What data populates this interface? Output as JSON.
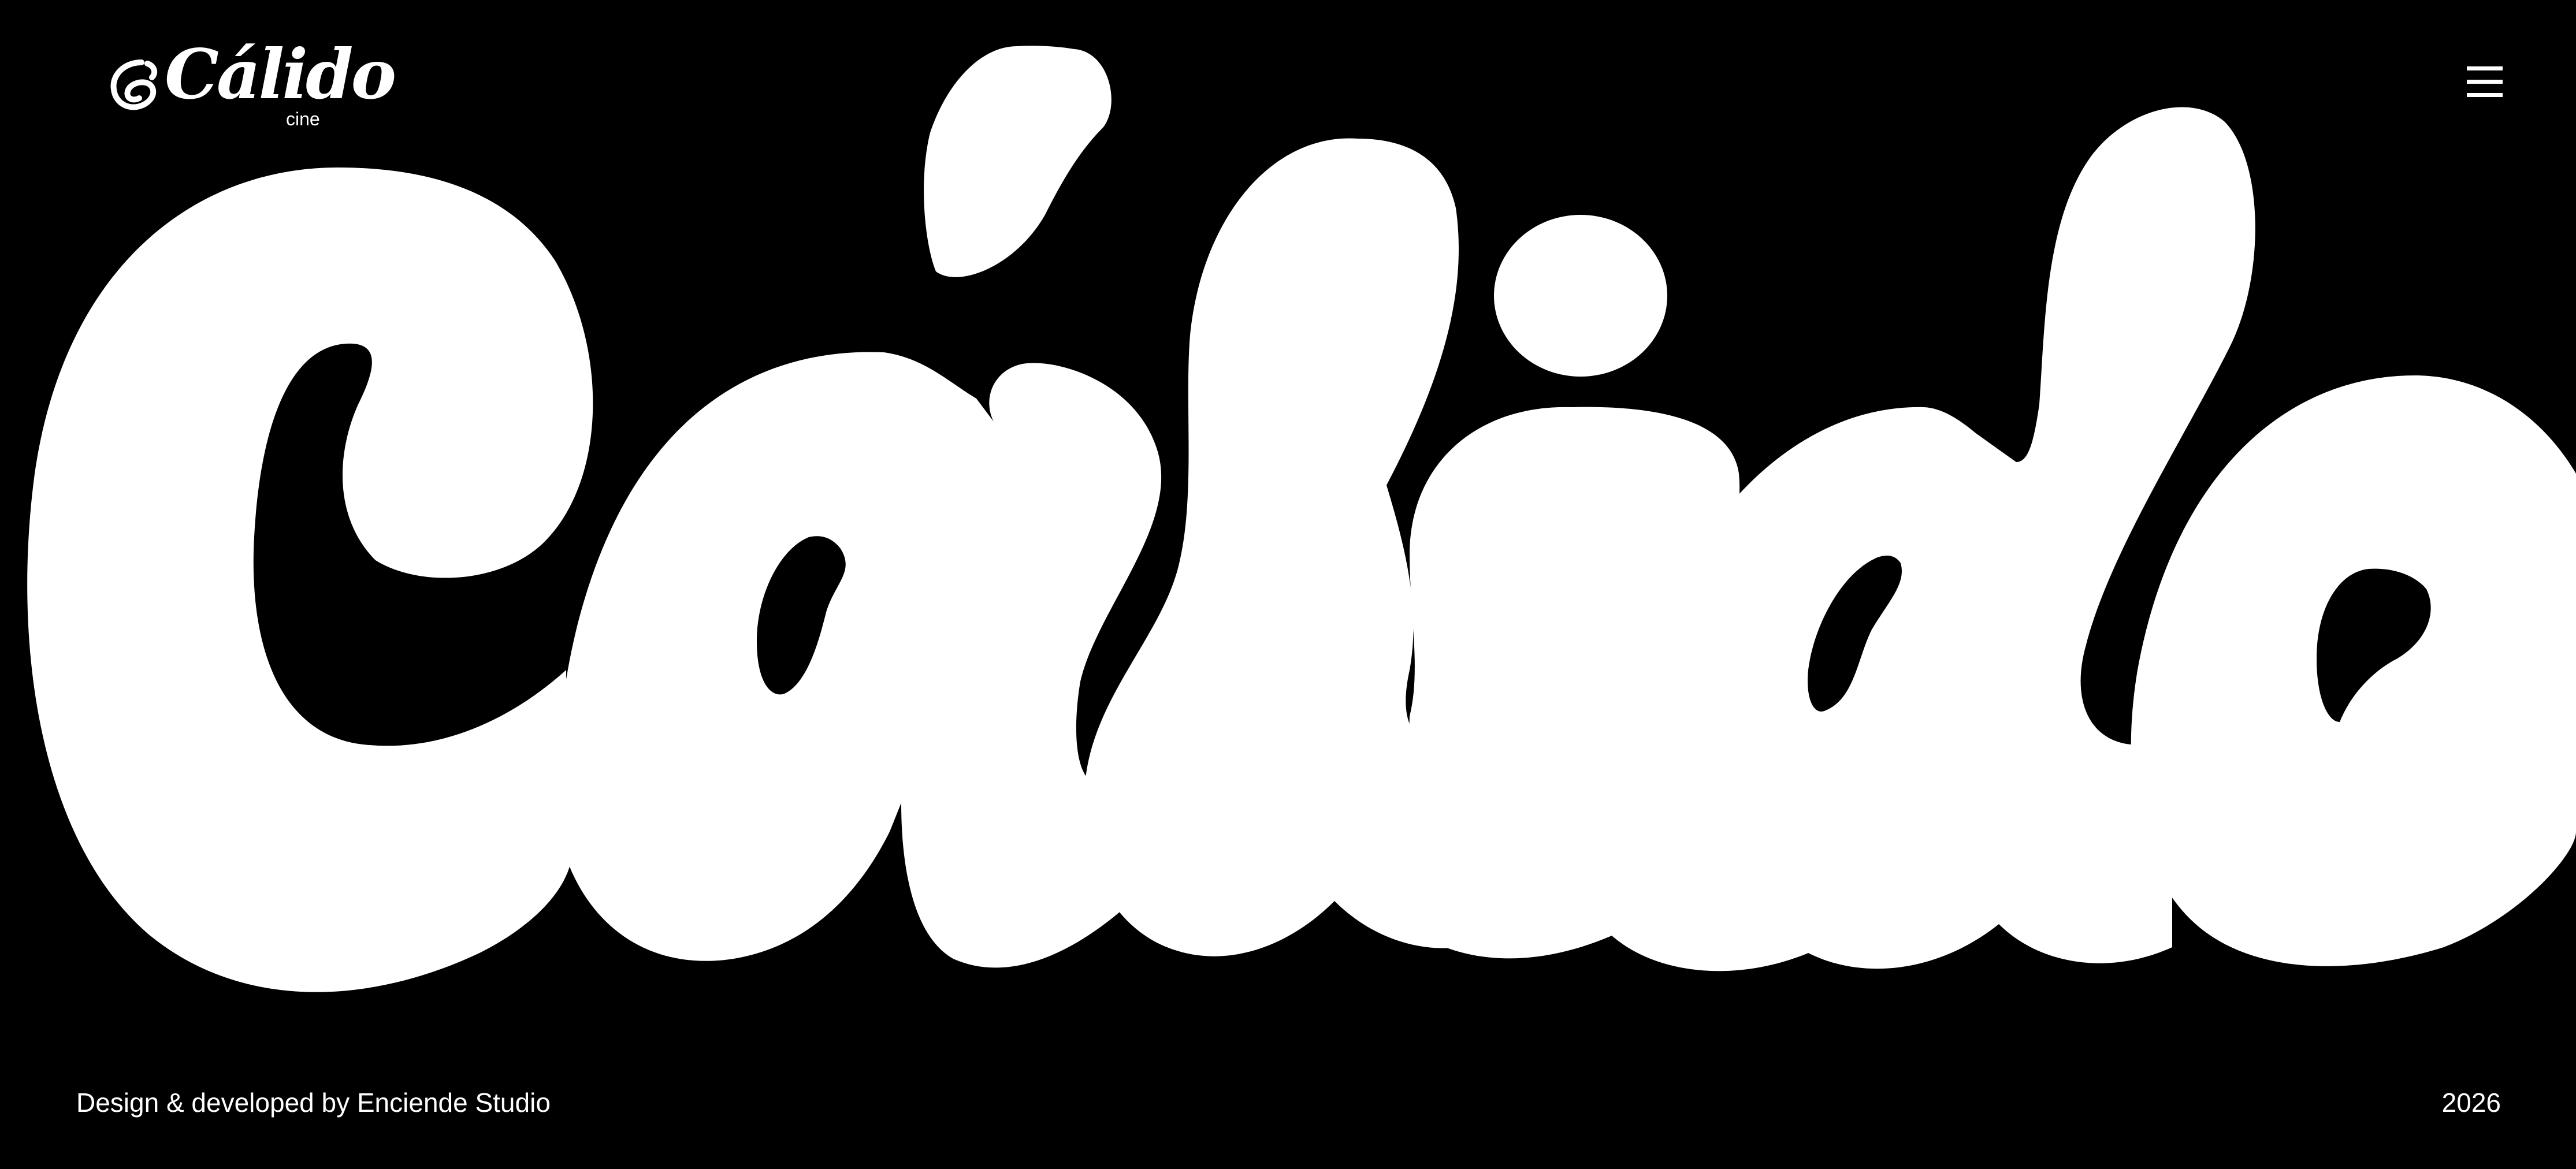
{
  "header": {
    "logo": {
      "word": "Cálido",
      "sub": "cine"
    },
    "menu_icon": "hamburger-menu-icon"
  },
  "hero": {
    "word": "Cálido",
    "colors": {
      "background": "#000000",
      "text": "#ffffff"
    }
  },
  "footer": {
    "credit": "Design & developed by Enciende Studio",
    "year": "2026"
  }
}
